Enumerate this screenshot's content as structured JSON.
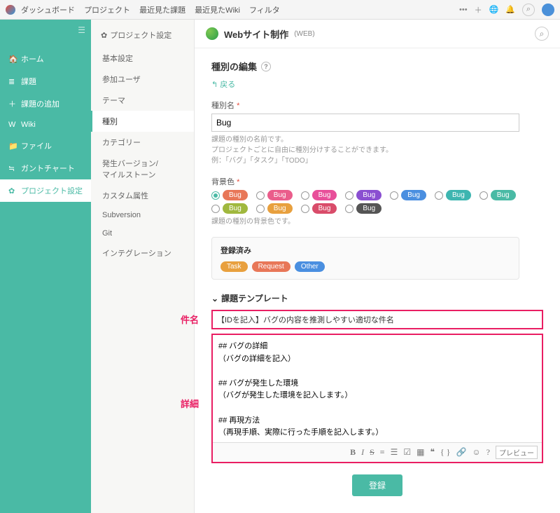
{
  "topbar": {
    "nav": [
      "ダッシュボード",
      "プロジェクト",
      "最近見た課題",
      "最近見たWiki",
      "フィルタ"
    ]
  },
  "sidebar": {
    "items": [
      {
        "icon": "🏠",
        "label": "ホーム"
      },
      {
        "icon": "≣",
        "label": "課題"
      },
      {
        "icon": "＋",
        "label": "課題の追加"
      },
      {
        "icon": "W",
        "label": "Wiki"
      },
      {
        "icon": "📁",
        "label": "ファイル"
      },
      {
        "icon": "≒",
        "label": "ガントチャート"
      },
      {
        "icon": "✿",
        "label": "プロジェクト設定"
      }
    ],
    "activeIndex": 6
  },
  "subnav": {
    "title": "プロジェクト設定",
    "items": [
      "基本設定",
      "参加ユーザ",
      "テーマ",
      "種別",
      "カテゴリー",
      "発生バージョン/\nマイルストーン",
      "カスタム属性",
      "Subversion",
      "Git",
      "インテグレーション"
    ],
    "activeIndex": 3
  },
  "project": {
    "name": "Webサイト制作",
    "key": "(WEB)"
  },
  "page": {
    "title": "種別の編集",
    "back": "戻る",
    "typeName": {
      "label": "種別名",
      "value": "Bug",
      "hint": "課題の種別の名前です。\nプロジェクトごとに自由に種別分けすることができます。\n例：「バグ」「タスク」「TODO」"
    },
    "bgColor": {
      "label": "背景色",
      "hint": "課題の種別の背景色です。",
      "options": [
        {
          "hex": "#e87758",
          "sel": true
        },
        {
          "hex": "#ea5d8b"
        },
        {
          "hex": "#e84f9a"
        },
        {
          "hex": "#8a4fd1"
        },
        {
          "hex": "#4a8fe0"
        },
        {
          "hex": "#3db5b0"
        },
        {
          "hex": "#4abaa5"
        },
        {
          "hex": "#a0b83e"
        },
        {
          "hex": "#e8a03e"
        },
        {
          "hex": "#d94c6a"
        },
        {
          "hex": "#555555"
        }
      ],
      "pillLabel": "Bug"
    },
    "registered": {
      "title": "登録済み",
      "chips": [
        {
          "label": "Task",
          "hex": "#e8a03e"
        },
        {
          "label": "Request",
          "hex": "#e87758"
        },
        {
          "label": "Other",
          "hex": "#4a8fe0"
        }
      ]
    },
    "templateHeader": "課題テンプレート",
    "annotSubject": "件名",
    "annotDetail": "詳細",
    "subject": "【IDを記入】バグの内容を推測しやすい適切な件名",
    "detail": "## バグの詳細\n（バグの詳細を記入）\n\n## バグが発生した環境\n（バグが発生した環境を記入します。）\n\n## 再現方法\n（再現手順、実際に行った手順を記入します。）\n\n## その他",
    "previewLabel": "プレビュー",
    "submit": "登録"
  }
}
